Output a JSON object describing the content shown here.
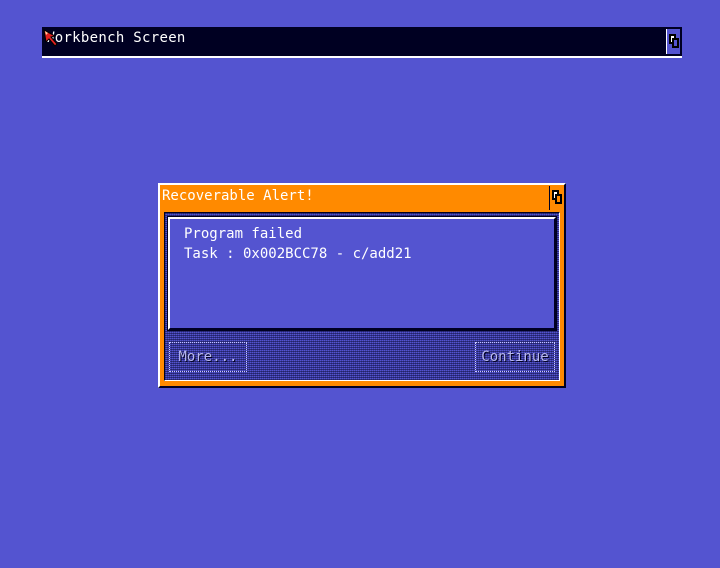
{
  "screen": {
    "title": "Workbench Screen",
    "depth_gadget_icon": "depth-arrange-icon"
  },
  "pointer": {
    "icon": "mouse-pointer-icon",
    "color": "#e02020"
  },
  "alert": {
    "title": "Recoverable Alert!",
    "message_lines": [
      "Program failed",
      "Task : 0x002BCC78 - c/add21"
    ],
    "buttons": {
      "more_label": "More...",
      "continue_label": "Continue"
    }
  },
  "colors": {
    "background": "#5454d0",
    "alert_accent": "#ff8a00",
    "title_bar": "#000022",
    "text": "#ffffff"
  }
}
